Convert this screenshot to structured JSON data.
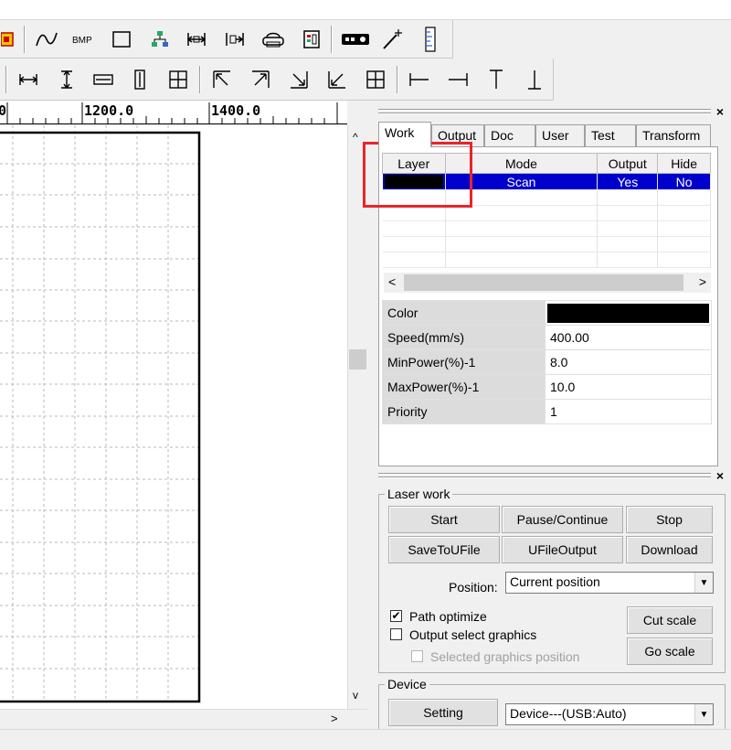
{
  "ruler": {
    "labels": [
      "0",
      "1200.0",
      "1400.0"
    ]
  },
  "tabs": [
    {
      "label": "Work",
      "active": true
    },
    {
      "label": "Output",
      "active": false
    },
    {
      "label": "Doc",
      "active": false
    },
    {
      "label": "User",
      "active": false
    },
    {
      "label": "Test",
      "active": false
    },
    {
      "label": "Transform",
      "active": false
    }
  ],
  "layer_table": {
    "headers": [
      "Layer",
      "Mode",
      "Output",
      "Hide"
    ],
    "rows": [
      {
        "color": "#000000",
        "mode": "Scan",
        "output": "Yes",
        "hide": "No",
        "selected": true
      }
    ]
  },
  "properties": [
    {
      "label": "Color",
      "value": "",
      "swatch": "#000000"
    },
    {
      "label": "Speed(mm/s)",
      "value": "400.00"
    },
    {
      "label": "MinPower(%)-1",
      "value": "8.0"
    },
    {
      "label": "MaxPower(%)-1",
      "value": "10.0"
    },
    {
      "label": "Priority",
      "value": "1"
    }
  ],
  "laser_work": {
    "title": "Laser work",
    "buttons": {
      "start": "Start",
      "pause": "Pause/Continue",
      "stop": "Stop",
      "save_to_ufile": "SaveToUFile",
      "ufile_output": "UFileOutput",
      "download": "Download",
      "cut_scale": "Cut scale",
      "go_scale": "Go scale"
    },
    "position_label": "Position:",
    "position_value": "Current position",
    "path_optimize": "Path optimize",
    "path_optimize_checked": true,
    "output_select_graphics": "Output select graphics",
    "output_select_graphics_checked": false,
    "selected_graphics_position": "Selected graphics position",
    "selected_graphics_position_checked": false
  },
  "device": {
    "title": "Device",
    "setting_label": "Setting",
    "device_value": "Device---(USB:Auto)"
  },
  "colors": {
    "selection_blue": "#0000cc",
    "highlight_red": "#e8252a",
    "layer_color": "#000000"
  },
  "icons": {
    "toolbar1": [
      "layer-color-icon",
      "curve-icon",
      "bmp-icon",
      "rectangle-icon",
      "tree-icon",
      "h-space-icon",
      "h-align-icon",
      "print-icon",
      "report-icon",
      "laser-head-icon",
      "magic-wand-icon",
      "ruler-icon"
    ],
    "toolbar2": [
      "same-width-icon",
      "same-height-icon",
      "h-size-icon",
      "v-size-icon",
      "center-grid-icon",
      "align-top-left-icon",
      "align-top-right-icon",
      "align-bottom-right-icon",
      "align-bottom-left-icon",
      "align-center-icon",
      "align-left-icon",
      "align-right-icon",
      "align-top-icon",
      "align-bottom-icon"
    ]
  }
}
